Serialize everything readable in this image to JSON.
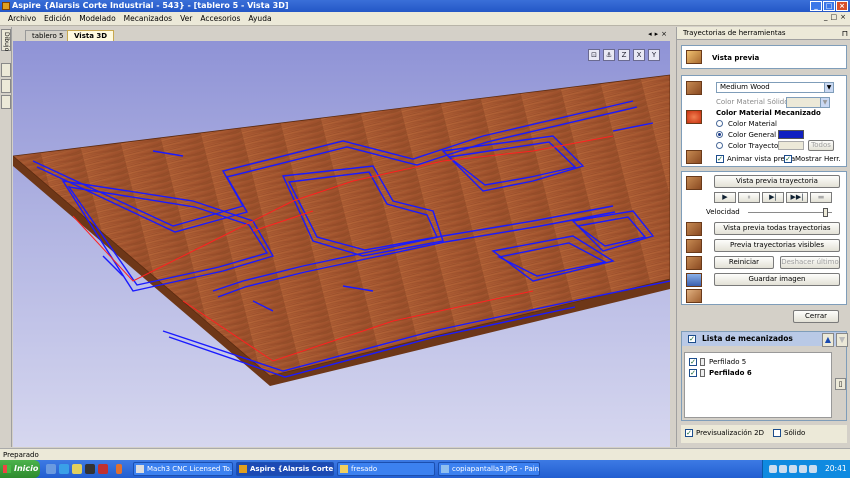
{
  "window": {
    "title": "Aspire {Alarsis Corte Industrial - 543} - [tablero 5 - Vista 3D]",
    "buttons": [
      "_",
      "□",
      "×"
    ]
  },
  "menu": {
    "items": [
      "Archivo",
      "Edición",
      "Modelado",
      "Mecanizados",
      "Ver",
      "Accesorios",
      "Ayuda"
    ],
    "right_controls": [
      "_",
      "□",
      "×"
    ]
  },
  "left_strip": {
    "tab_label": "Dibujo"
  },
  "doc_tabs": {
    "tabs": [
      {
        "label": "tablero 5",
        "active": false
      },
      {
        "label": "Vista 3D",
        "active": true
      }
    ],
    "nav": [
      "◂",
      "▸",
      "×"
    ]
  },
  "view_toolbar": {
    "icons": [
      "fit-view-icon",
      "iso-view-icon",
      "z-axis-icon",
      "x-axis-icon",
      "y-axis-icon"
    ],
    "glyphs": [
      "⊡",
      "⚓",
      "Z",
      "X",
      "Y"
    ]
  },
  "panel": {
    "title": "Trayectorias de herramientas",
    "pin": "⊓",
    "preview": {
      "heading": "Vista previa",
      "material": "Medium Wood",
      "solid_color_label": "Color Material Sólido",
      "machined_color_heading": "Color Material Mecanizado",
      "radio_material": "Color Material",
      "radio_general": "Color General",
      "radio_toolpath": "Color Trayectori",
      "todos_button": "Todos",
      "animate_label": "Animar vista previa",
      "show_tool_label": "Mostrar Herr.",
      "general_color": "#1020c0"
    },
    "controls": {
      "preview_toolpath": "Vista previa trayectoria",
      "playback": [
        "▶",
        "⏸",
        "▶|",
        "▶▶|",
        "▬"
      ],
      "speed_label": "Velocidad",
      "speed_value": 0.95,
      "preview_all": "Vista previa todas trayectorias",
      "preview_visible": "Previa trayectorias visibles",
      "reset": "Reiniciar",
      "undo_last": "Deshacer último",
      "save_image": "Guardar imagen"
    },
    "close_button": "Cerrar",
    "toolpath_list": {
      "heading": "Lista de mecanizados",
      "items": [
        {
          "label": "Perfilado 5",
          "checked": true,
          "bold": false
        },
        {
          "label": "Perfilado 6",
          "checked": true,
          "bold": true
        }
      ],
      "up_arrow": "▲",
      "down_arrow": "▲"
    },
    "bottom": {
      "preview_2d": "Previsualización 2D",
      "solid": "Sólido"
    }
  },
  "statusbar": {
    "text": "Preparado"
  },
  "taskbar": {
    "start_label": "Inicio",
    "tasks": [
      {
        "label": "Mach3 CNC  Licensed To...",
        "active": false
      },
      {
        "label": "Aspire {Alarsis Corte ...",
        "active": true
      },
      {
        "label": "fresado",
        "active": false
      },
      {
        "label": "copiapantalla3.JPG - Paint",
        "active": false
      }
    ],
    "clock": "20:41"
  },
  "colors": {
    "board": "#a0522d",
    "toolpath": "#1a1aff",
    "plunge": "#ff2020",
    "background_top": "#8f93d6",
    "background_bottom": "#d6d7ef"
  }
}
